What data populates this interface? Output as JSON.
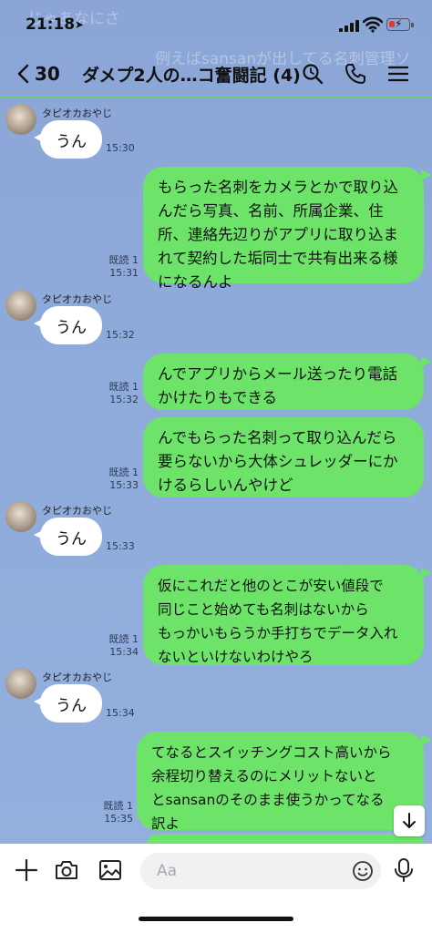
{
  "status": {
    "time": "21:18",
    "location_icon": "location-arrow-icon",
    "battery_color": "#e33333"
  },
  "header": {
    "back_count": "30",
    "title": "ダメプ2人の…コ奮闘記 (4)"
  },
  "background_ghost": {
    "line1": "じゃあなにさ",
    "line2": "例えばsansanが出してる名刺管理ソ"
  },
  "messages": [
    {
      "side": "in",
      "sender": "タピオカおやじ",
      "text": "うん",
      "time": "15:30"
    },
    {
      "side": "out",
      "lines": [
        "もらった名刺をカメラとかで取り込",
        "んだら写真、名前、所属企業、住",
        "所、連絡先辺りがアプリに取り込ま",
        "れて契約した垢同士で共有出来る様",
        "になるんよ"
      ],
      "read": "既読 1",
      "time": "15:31"
    },
    {
      "side": "in",
      "sender": "タピオカおやじ",
      "text": "うん",
      "time": "15:32"
    },
    {
      "side": "out",
      "lines": [
        "んでアプリからメール送ったり電話",
        "かけたりもできる"
      ],
      "read": "既読 1",
      "time": "15:32"
    },
    {
      "side": "out",
      "lines": [
        "んでもらった名刺って取り込んだら",
        "要らないから大体シュレッダーにか",
        "けるらしいんやけど"
      ],
      "read": "既読 1",
      "time": "15:33"
    },
    {
      "side": "in",
      "sender": "タピオカおやじ",
      "text": "うん",
      "time": "15:33"
    },
    {
      "side": "out",
      "lines": [
        "仮にこれだと他のとこが安い値段で",
        "同じこと始めても名刺はないから",
        "もっかいもらうか手打ちでデータ入れ",
        "ないといけないわけやろ"
      ],
      "read": "既読 1",
      "time": "15:34"
    },
    {
      "side": "in",
      "sender": "タピオカおやじ",
      "text": "うん",
      "time": "15:34"
    },
    {
      "side": "out",
      "lines": [
        "てなるとスイッチングコスト高いから",
        "余程切り替えるのにメリットないと",
        "とsansanのそのまま使うかってなる",
        "訳よ"
      ],
      "read": "既読 1",
      "time": "15:35"
    }
  ],
  "input": {
    "placeholder": "Aa"
  },
  "colors": {
    "bubble_out": "#6ee36a",
    "bubble_in": "#ffffff",
    "chat_bg": "#8fabdb"
  }
}
